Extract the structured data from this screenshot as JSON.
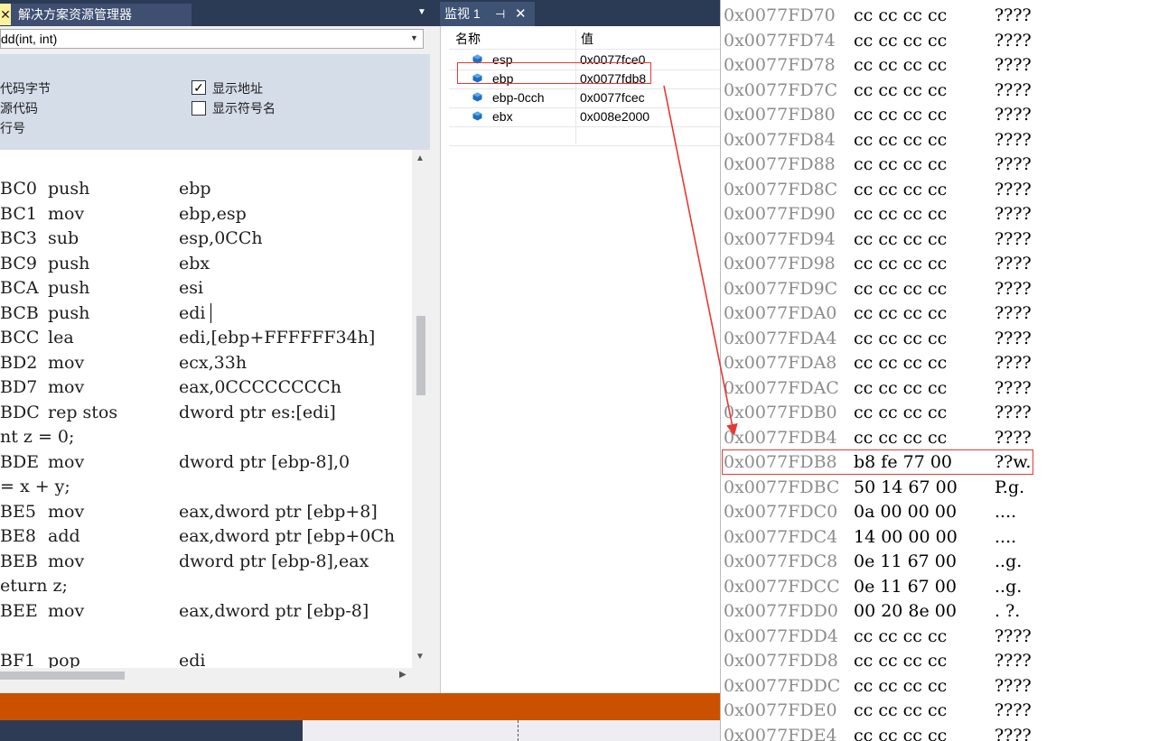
{
  "solution_explorer": {
    "close_glyph": "✕",
    "tab_label": "解决方案资源管理器",
    "dropdown_glyph": "▼"
  },
  "disassembly": {
    "function_selector": "dd(int, int)",
    "options": {
      "code_bytes": "代码字节",
      "source_code": "源代码",
      "line_numbers": "行号",
      "show_address": "显示地址",
      "show_address_checked": "✓",
      "show_symbol_names": "显示符号名"
    },
    "lines": [
      {
        "addr": "BC0",
        "mnemonic": "push",
        "operand": "ebp"
      },
      {
        "addr": "BC1",
        "mnemonic": "mov",
        "operand": "ebp,esp"
      },
      {
        "addr": "BC3",
        "mnemonic": "sub",
        "operand": "esp,0CCh"
      },
      {
        "addr": "BC9",
        "mnemonic": "push",
        "operand": "ebx"
      },
      {
        "addr": "BCA",
        "mnemonic": "push",
        "operand": "esi"
      },
      {
        "addr": "BCB",
        "mnemonic": "push",
        "operand": "edi"
      },
      {
        "addr": "BCC",
        "mnemonic": "lea",
        "operand": "edi,[ebp+FFFFFF34h]"
      },
      {
        "addr": "BD2",
        "mnemonic": "mov",
        "operand": "ecx,33h"
      },
      {
        "addr": "BD7",
        "mnemonic": "mov",
        "operand": "eax,0CCCCCCCCh"
      },
      {
        "addr": "BDC",
        "mnemonic": "rep stos",
        "operand": "dword ptr es:[edi]"
      },
      {
        "source": "nt z = 0;"
      },
      {
        "addr": "BDE",
        "mnemonic": "mov",
        "operand": "dword ptr [ebp-8],0"
      },
      {
        "source": "= x + y;"
      },
      {
        "addr": "BE5",
        "mnemonic": "mov",
        "operand": "eax,dword ptr [ebp+8]"
      },
      {
        "addr": "BE8",
        "mnemonic": "add",
        "operand": "eax,dword ptr [ebp+0Ch"
      },
      {
        "addr": "BEB",
        "mnemonic": "mov",
        "operand": "dword ptr [ebp-8],eax"
      },
      {
        "source": "eturn z;"
      },
      {
        "addr": "BEE",
        "mnemonic": "mov",
        "operand": "eax,dword ptr [ebp-8]"
      },
      {
        "source": ""
      },
      {
        "addr": "BF1",
        "mnemonic": "pop",
        "operand": "edi"
      }
    ]
  },
  "watch": {
    "tab_label": "监视 1",
    "pin_glyph": "⊣",
    "close_glyph": "✕",
    "columns": {
      "name": "名称",
      "value": "值"
    },
    "rows": [
      {
        "name": "esp",
        "value": "0x0077fce0"
      },
      {
        "name": "ebp",
        "value": "0x0077fdb8"
      },
      {
        "name": "ebp-0cch",
        "value": "0x0077fcec"
      },
      {
        "name": "ebx",
        "value": "0x008e2000"
      }
    ]
  },
  "memory": {
    "rows": [
      {
        "addr": "0x0077FD70",
        "bytes": "cc cc cc cc",
        "ascii": "????"
      },
      {
        "addr": "0x0077FD74",
        "bytes": "cc cc cc cc",
        "ascii": "????"
      },
      {
        "addr": "0x0077FD78",
        "bytes": "cc cc cc cc",
        "ascii": "????"
      },
      {
        "addr": "0x0077FD7C",
        "bytes": "cc cc cc cc",
        "ascii": "????"
      },
      {
        "addr": "0x0077FD80",
        "bytes": "cc cc cc cc",
        "ascii": "????"
      },
      {
        "addr": "0x0077FD84",
        "bytes": "cc cc cc cc",
        "ascii": "????"
      },
      {
        "addr": "0x0077FD88",
        "bytes": "cc cc cc cc",
        "ascii": "????"
      },
      {
        "addr": "0x0077FD8C",
        "bytes": "cc cc cc cc",
        "ascii": "????"
      },
      {
        "addr": "0x0077FD90",
        "bytes": "cc cc cc cc",
        "ascii": "????"
      },
      {
        "addr": "0x0077FD94",
        "bytes": "cc cc cc cc",
        "ascii": "????"
      },
      {
        "addr": "0x0077FD98",
        "bytes": "cc cc cc cc",
        "ascii": "????"
      },
      {
        "addr": "0x0077FD9C",
        "bytes": "cc cc cc cc",
        "ascii": "????"
      },
      {
        "addr": "0x0077FDA0",
        "bytes": "cc cc cc cc",
        "ascii": "????"
      },
      {
        "addr": "0x0077FDA4",
        "bytes": "cc cc cc cc",
        "ascii": "????"
      },
      {
        "addr": "0x0077FDA8",
        "bytes": "cc cc cc cc",
        "ascii": "????"
      },
      {
        "addr": "0x0077FDAC",
        "bytes": "cc cc cc cc",
        "ascii": "????"
      },
      {
        "addr": "0x0077FDB0",
        "bytes": "cc cc cc cc",
        "ascii": "????"
      },
      {
        "addr": "0x0077FDB4",
        "bytes": "cc cc cc cc",
        "ascii": "????"
      },
      {
        "addr": "0x0077FDB8",
        "bytes": "b8 fe 77 00",
        "ascii": "??w."
      },
      {
        "addr": "0x0077FDBC",
        "bytes": "50 14 67 00",
        "ascii": "P.g."
      },
      {
        "addr": "0x0077FDC0",
        "bytes": "0a 00 00 00",
        "ascii": "...."
      },
      {
        "addr": "0x0077FDC4",
        "bytes": "14 00 00 00",
        "ascii": "...."
      },
      {
        "addr": "0x0077FDC8",
        "bytes": "0e 11 67 00",
        "ascii": "..g."
      },
      {
        "addr": "0x0077FDCC",
        "bytes": "0e 11 67 00",
        "ascii": "..g."
      },
      {
        "addr": "0x0077FDD0",
        "bytes": "00 20 8e 00",
        "ascii": ". ?."
      },
      {
        "addr": "0x0077FDD4",
        "bytes": "cc cc cc cc",
        "ascii": "????"
      },
      {
        "addr": "0x0077FDD8",
        "bytes": "cc cc cc cc",
        "ascii": "????"
      },
      {
        "addr": "0x0077FDDC",
        "bytes": "cc cc cc cc",
        "ascii": "????"
      },
      {
        "addr": "0x0077FDE0",
        "bytes": "cc cc cc cc",
        "ascii": "????"
      },
      {
        "addr": "0x0077FDE4",
        "bytes": "cc cc cc cc",
        "ascii": "????"
      }
    ]
  },
  "colors": {
    "highlight": "#e53935",
    "status_orange": "#ca5100",
    "tab_dark": "#2b3a55",
    "address_gray": "#8c8c8c"
  }
}
